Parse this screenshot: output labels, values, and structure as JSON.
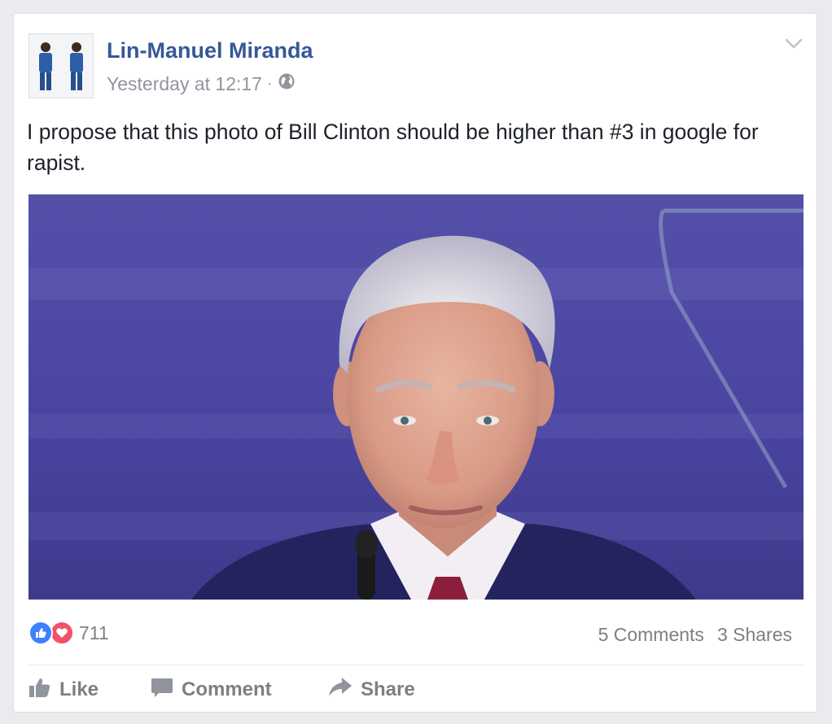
{
  "post": {
    "author": "Lin-Manuel Miranda",
    "timestamp": "Yesterday at 12:17",
    "separator": "·",
    "privacy_icon": "globe-icon",
    "menu_icon": "chevron-down-icon",
    "text": "I propose that this photo of Bill Clinton should be higher than #3 in google for rapist."
  },
  "engagement": {
    "reaction_icons": [
      "like-reaction-icon",
      "love-reaction-icon"
    ],
    "reaction_count": "711",
    "comments": "5 Comments",
    "shares": "3 Shares"
  },
  "actions": {
    "like": "Like",
    "comment": "Comment",
    "share": "Share"
  },
  "colors": {
    "author_link": "#365899",
    "meta_gray": "#90949c",
    "like_blue": "#4080ff",
    "love_red": "#f25268",
    "action_gray": "#7f7f7f",
    "photo_background": "#4a44a0"
  }
}
